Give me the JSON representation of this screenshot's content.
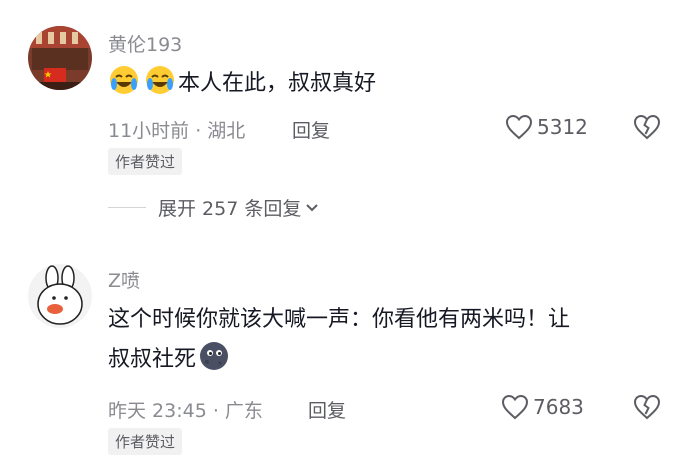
{
  "comments": [
    {
      "username": "黄伦193",
      "content_text": "本人在此，叔叔真好",
      "emoji_icons": [
        "laugh-cry-emoji-icon",
        "laugh-cry-emoji-icon"
      ],
      "meta": "11小时前 · 湖北",
      "reply_label": "回复",
      "like_count": "5312",
      "author_liked": "作者赞过",
      "expand_label": "展开 257 条回复"
    },
    {
      "username": "Z喷",
      "content_line1": "这个时候你就该大喊一声：你看他有两米吗！让",
      "content_line2": "叔叔社死",
      "emoji_icons": [
        "dark-moon-face-emoji-icon"
      ],
      "meta": "昨天 23:45 · 广东",
      "reply_label": "回复",
      "like_count": "7683",
      "author_liked": "作者赞过"
    }
  ],
  "colors": {
    "primary_text": "#161823",
    "secondary_text": "#8a8b91",
    "badge_bg": "#f1f1f2"
  }
}
